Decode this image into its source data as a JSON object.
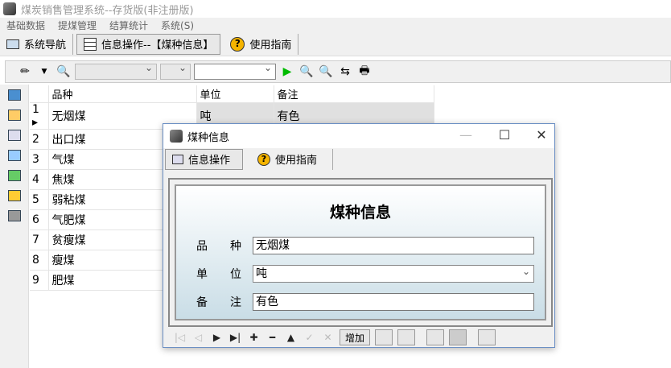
{
  "app": {
    "title": "煤炭销售管理系统--存货版(非注册版)"
  },
  "menu": [
    "基础数据",
    "提煤管理",
    "结算统计",
    "系统(S)"
  ],
  "tabs": [
    {
      "label": "系统导航"
    },
    {
      "label": "信息操作--【煤种信息】"
    },
    {
      "label": "使用指南"
    }
  ],
  "grid": {
    "headers": [
      "品种",
      "单位",
      "备注"
    ],
    "rows": [
      {
        "n": "1",
        "name": "无烟煤",
        "unit": "吨",
        "note": "有色"
      },
      {
        "n": "2",
        "name": "出口煤",
        "unit": "",
        "note": ""
      },
      {
        "n": "3",
        "name": "气煤",
        "unit": "",
        "note": ""
      },
      {
        "n": "4",
        "name": "焦煤",
        "unit": "",
        "note": ""
      },
      {
        "n": "5",
        "name": "弱粘煤",
        "unit": "",
        "note": ""
      },
      {
        "n": "6",
        "name": "气肥煤",
        "unit": "",
        "note": ""
      },
      {
        "n": "7",
        "name": "贫瘦煤",
        "unit": "",
        "note": ""
      },
      {
        "n": "8",
        "name": "瘦煤",
        "unit": "",
        "note": ""
      },
      {
        "n": "9",
        "name": "肥煤",
        "unit": "",
        "note": ""
      }
    ]
  },
  "dialog": {
    "title": "煤种信息",
    "tabs": [
      "信息操作",
      "使用指南"
    ],
    "heading": "煤种信息",
    "fields": [
      {
        "l1": "品",
        "l2": "种",
        "value": "无烟煤"
      },
      {
        "l1": "单",
        "l2": "位",
        "value": "吨"
      },
      {
        "l1": "备",
        "l2": "注",
        "value": "有色"
      }
    ],
    "add_label": "增加"
  }
}
